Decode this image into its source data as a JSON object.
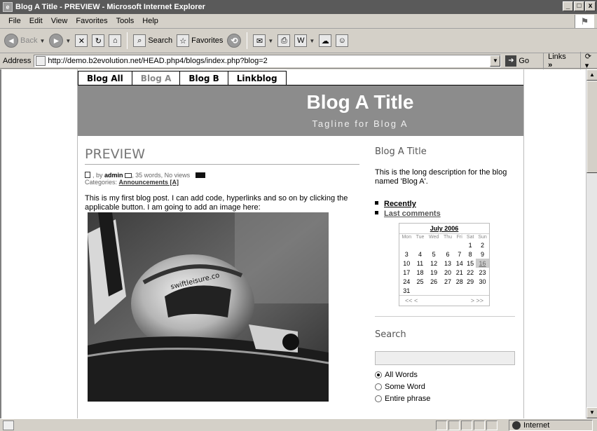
{
  "window": {
    "title": "Blog A Title - PREVIEW - Microsoft Internet Explorer",
    "controls": [
      "_",
      "□",
      "x"
    ]
  },
  "menu": [
    "File",
    "Edit",
    "View",
    "Favorites",
    "Tools",
    "Help"
  ],
  "toolbar": {
    "back": "Back",
    "search": "Search",
    "favorites": "Favorites"
  },
  "address": {
    "label": "Address",
    "url": "http://demo.b2evolution.net/HEAD.php4/blogs/index.php?blog=2",
    "go": "Go",
    "links": "Links",
    "links_more": "»"
  },
  "status": {
    "zone": "Internet"
  },
  "blog": {
    "tabs": [
      {
        "label": "Blog All",
        "active": false
      },
      {
        "label": "Blog A",
        "active": true
      },
      {
        "label": "Blog B",
        "active": false
      },
      {
        "label": "Linkblog",
        "active": false
      }
    ],
    "title": "Blog A Title",
    "tagline": "Tagline for Blog A"
  },
  "post": {
    "title": "PREVIEW",
    "meta_by": ", by",
    "author": "admin",
    "meta_rest": ", 35 words, No views",
    "categories_label": "Categories:",
    "category": "Announcements [A]",
    "body": "This is my first blog post. I can add code, hyperlinks and so on by clicking the applicable button. I am going to add an image here:",
    "image_text": "swiftleisure.co"
  },
  "sidebar": {
    "title": "Blog A Title",
    "description": "This is the long description for the blog named 'Blog A'.",
    "links": [
      "Recently",
      "Last comments"
    ],
    "calendar": {
      "month": "July 2006",
      "days": [
        "Mon",
        "Tue",
        "Wed",
        "Thu",
        "Fri",
        "Sat",
        "Sun"
      ],
      "weeks": [
        [
          "",
          "",
          "",
          "",
          "",
          "1",
          "2"
        ],
        [
          "3",
          "4",
          "5",
          "6",
          "7",
          "8",
          "9"
        ],
        [
          "10",
          "11",
          "12",
          "13",
          "14",
          "15",
          "16"
        ],
        [
          "17",
          "18",
          "19",
          "20",
          "21",
          "22",
          "23"
        ],
        [
          "24",
          "25",
          "26",
          "27",
          "28",
          "29",
          "30"
        ],
        [
          "31",
          "",
          "",
          "",
          "",
          "",
          ""
        ]
      ],
      "today": "16",
      "nav_prev": "<<  <",
      "nav_next": ">  >>"
    },
    "search_title": "Search",
    "search_options": [
      {
        "label": "All Words",
        "checked": true
      },
      {
        "label": "Some Word",
        "checked": false
      },
      {
        "label": "Entire phrase",
        "checked": false
      }
    ]
  }
}
